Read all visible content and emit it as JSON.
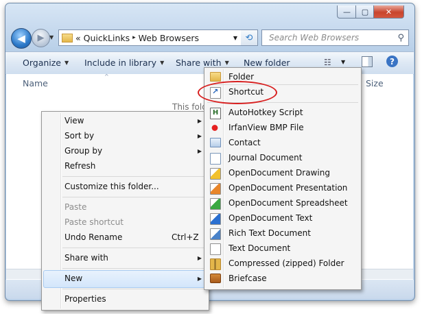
{
  "window": {
    "caption_buttons": {
      "minimize": "—",
      "maximize": "▢",
      "close": "✕"
    }
  },
  "nav": {
    "back_icon": "◀",
    "forward_icon": "▶",
    "history_dropdown_icon": "▼"
  },
  "address_bar": {
    "overflow_chevron": "«",
    "segments": [
      "QuickLinks",
      "Web Browsers"
    ],
    "separator": "▸",
    "dropdown_icon": "▼",
    "refresh_icon": "⟲"
  },
  "search": {
    "placeholder": "Search Web Browsers",
    "icon": "⚲"
  },
  "toolbar": {
    "organize": "Organize",
    "include_in_library": "Include in library",
    "share_with": "Share with",
    "new_folder": "New folder",
    "views_icon": "☷",
    "help_icon": "?"
  },
  "columns": {
    "name": "Name",
    "size": "Size",
    "sort_arrow": "^"
  },
  "content": {
    "empty_message": "This fold"
  },
  "context_menu": {
    "view": "View",
    "sort_by": "Sort by",
    "group_by": "Group by",
    "refresh": "Refresh",
    "customize": "Customize this folder...",
    "paste": "Paste",
    "paste_shortcut": "Paste shortcut",
    "undo_rename": "Undo Rename",
    "undo_rename_shortcut": "Ctrl+Z",
    "share_with": "Share with",
    "new": "New",
    "properties": "Properties",
    "submenu_arrow": "▶"
  },
  "new_submenu": {
    "items": [
      "Folder",
      "Shortcut",
      "AutoHotkey Script",
      "IrfanView BMP File",
      "Contact",
      "Journal Document",
      "OpenDocument Drawing",
      "OpenDocument Presentation",
      "OpenDocument Spreadsheet",
      "OpenDocument Text",
      "Rich Text Document",
      "Text Document",
      "Compressed (zipped) Folder",
      "Briefcase"
    ],
    "highlighted_item": "Shortcut",
    "highlight_color": "#d81f1f"
  }
}
